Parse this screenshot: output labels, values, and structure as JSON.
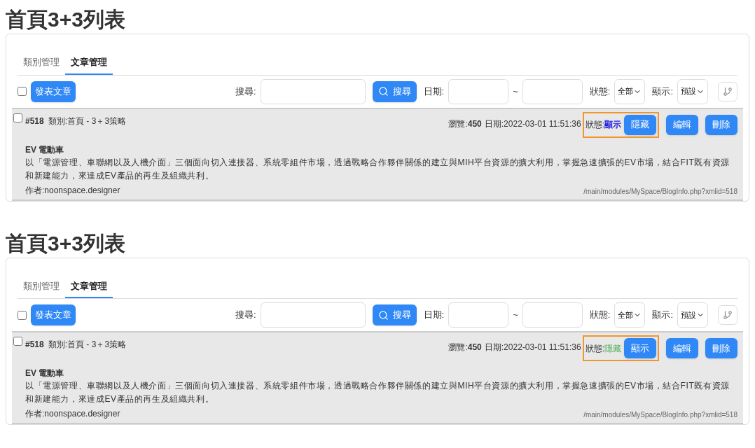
{
  "panels": [
    {
      "heading": "首頁3+3列表",
      "tabs": [
        {
          "label": "類別管理",
          "selected": false
        },
        {
          "label": "文章管理",
          "selected": true
        }
      ],
      "toolbar": {
        "select_all_checked": false,
        "post_button": "發表文章",
        "search_label": "搜尋:",
        "search_button": "搜尋",
        "date_label": "日期:",
        "date_separator": "~",
        "status_label": "狀態:",
        "status_value": "全部",
        "display_label": "顯示:",
        "display_value": "預設"
      },
      "article": {
        "checked": false,
        "id": "#518",
        "category": "類別:首頁 - 3＋3策略",
        "views_label": "瀏覽:",
        "views": "450",
        "date": "日期:2022-03-01 11:51:36",
        "status_label": "狀態:",
        "status_value": "顯示",
        "kind": "shown",
        "highlighted": true,
        "toggle_button": "隱藏",
        "edit_button": "編輯",
        "delete_button": "刪除",
        "title": "EV 電動車",
        "body": "以「電源管理、車聯網以及人機介面」三個面向切入連接器、系統零組件市場，透過戰略合作夥伴關係的建立與MIH平台資源的擴大利用，掌握急速擴張的EV市場，結合FIT既有資源和新建能力，來達成EV產品的再生及組織共利。",
        "author": "作者:noonspace.designer",
        "url": "/main/modules/MySpace/BlogInfo.php?xmlid=518"
      }
    },
    {
      "heading": "首頁3+3列表",
      "tabs": [
        {
          "label": "類別管理",
          "selected": false
        },
        {
          "label": "文章管理",
          "selected": true
        }
      ],
      "toolbar": {
        "select_all_checked": false,
        "post_button": "發表文章",
        "search_label": "搜尋:",
        "search_button": "搜尋",
        "date_label": "日期:",
        "date_separator": "~",
        "status_label": "狀態:",
        "status_value": "全部",
        "display_label": "顯示:",
        "display_value": "預設"
      },
      "article": {
        "checked": false,
        "id": "#518",
        "category": "類別:首頁 - 3＋3策略",
        "views_label": "瀏覽:",
        "views": "450",
        "date": "日期:2022-03-01 11:51:36",
        "status_label": "狀態:",
        "status_value": "隱藏",
        "kind": "hidden",
        "highlighted": true,
        "toggle_button": "顯示",
        "edit_button": "編輯",
        "delete_button": "刪除",
        "title": "EV 電動車",
        "body": "以「電源管理、車聯網以及人機介面」三個面向切入連接器、系統零組件市場，透過戰略合作夥伴關係的建立與MIH平台資源的擴大利用，掌握急速擴張的EV市場，結合FIT既有資源和新建能力，來達成EV產品的再生及組織共利。",
        "author": "作者:noonspace.designer",
        "url": "/main/modules/MySpace/BlogInfo.php?xmlid=518"
      }
    }
  ]
}
